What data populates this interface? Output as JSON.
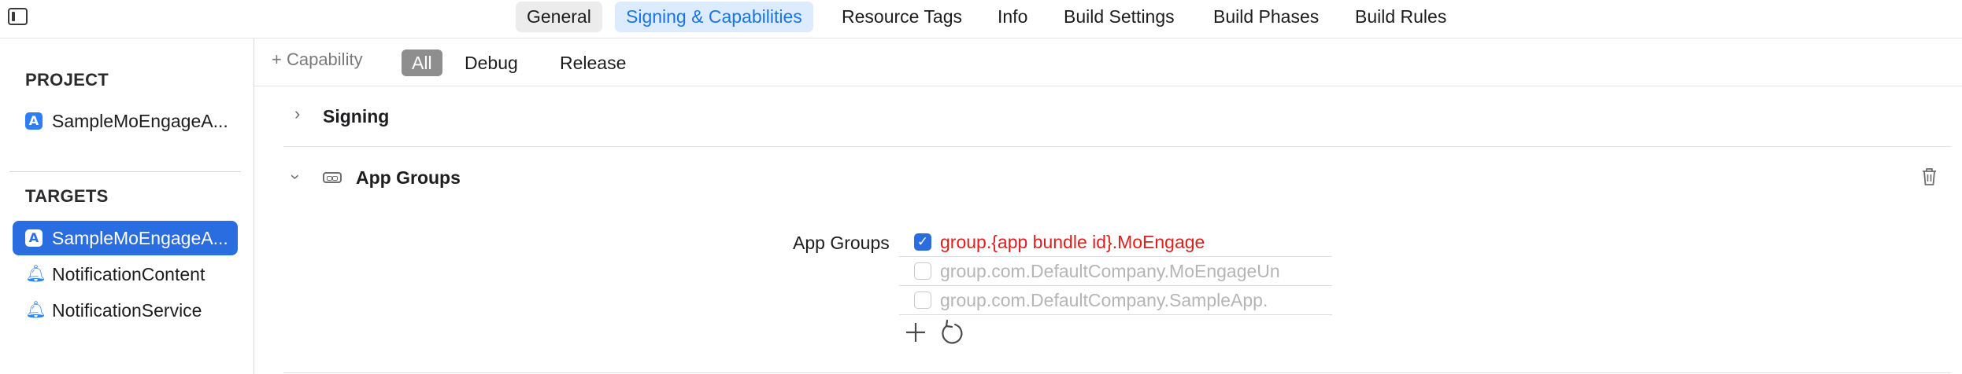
{
  "tabs": {
    "general": "General",
    "signing": "Signing & Capabilities",
    "resource_tags": "Resource Tags",
    "info": "Info",
    "build_settings": "Build Settings",
    "build_phases": "Build Phases",
    "build_rules": "Build Rules",
    "selected": "Signing & Capabilities"
  },
  "sidebar": {
    "project_header": "PROJECT",
    "project_item": "SampleMoEngageA...",
    "targets_header": "TARGETS",
    "targets": [
      {
        "label": "SampleMoEngageA...",
        "icon": "app-icon",
        "selected": true
      },
      {
        "label": "NotificationContent",
        "icon": "bell-icon",
        "selected": false
      },
      {
        "label": "NotificationService",
        "icon": "bell-icon",
        "selected": false
      }
    ]
  },
  "toolbar": {
    "add_capability": "+ Capability",
    "filters": [
      "All",
      "Debug",
      "Release"
    ],
    "selected_filter": "All"
  },
  "capabilities": {
    "signing_title": "Signing",
    "app_groups_title": "App Groups",
    "app_groups_label": "App Groups",
    "groups": [
      {
        "name": "group.{app bundle id}.MoEngage",
        "checked": true
      },
      {
        "name": "group.com.DefaultCompany.MoEngageUn",
        "checked": false
      },
      {
        "name": "group.com.DefaultCompany.SampleApp.",
        "checked": false
      }
    ]
  },
  "colors": {
    "accent": "#2a6de0",
    "selected_tab_bg": "#dcebfd",
    "error_text": "#dd1f1f"
  }
}
